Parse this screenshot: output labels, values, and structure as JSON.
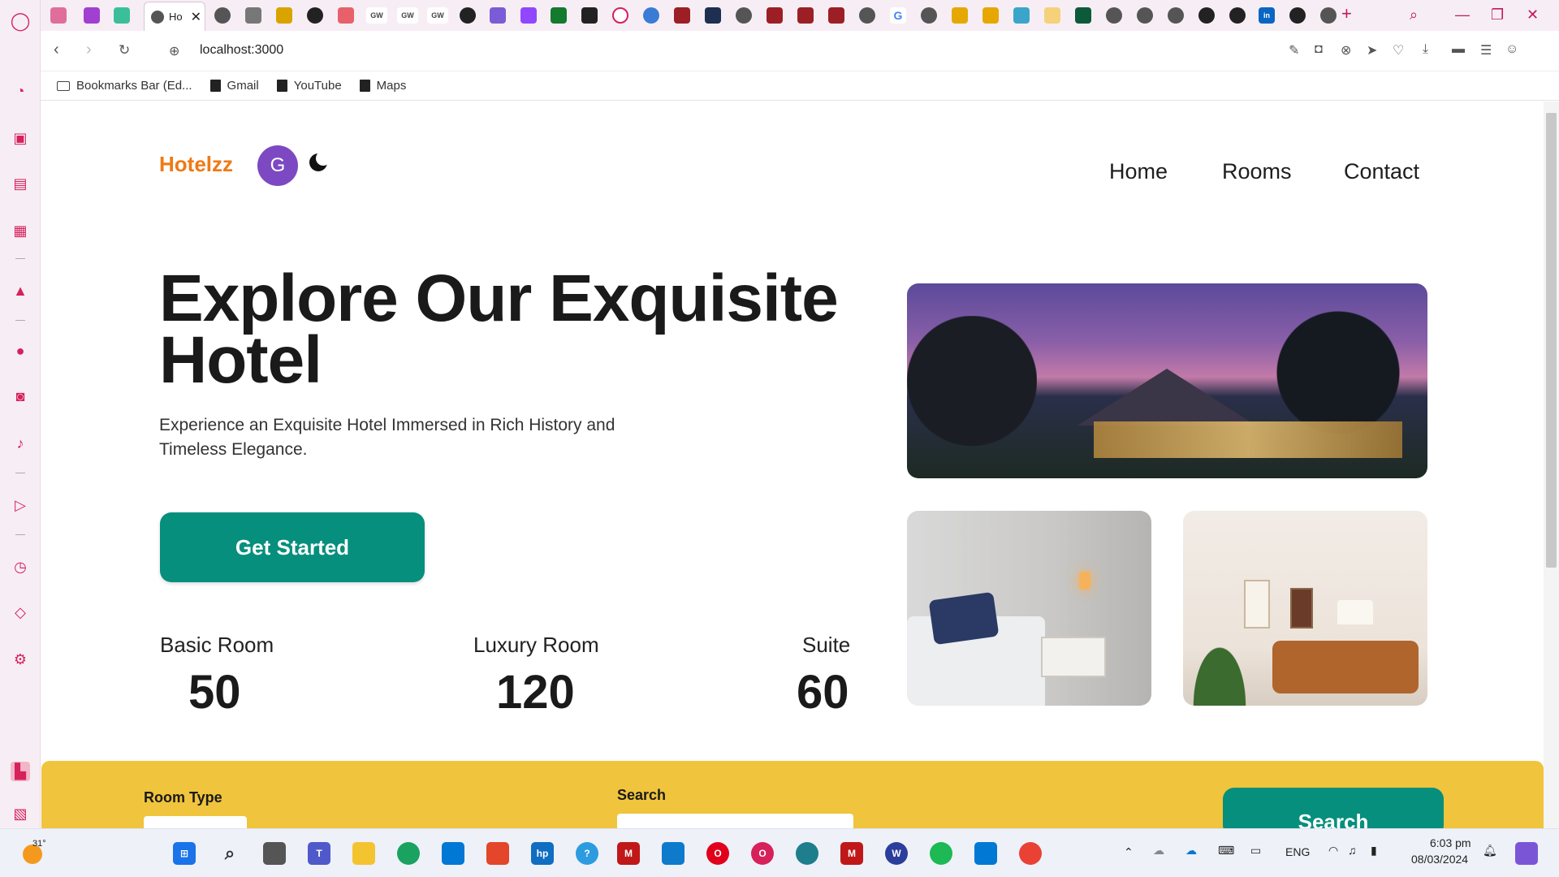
{
  "browser": {
    "active_tab_title": "Ho",
    "url": "localhost:3000",
    "bookmarks": [
      "Bookmarks Bar (Ed...",
      "Gmail",
      "YouTube",
      "Maps"
    ],
    "tab_favicons": [
      "GW",
      "GW",
      "GW",
      "G",
      "in"
    ]
  },
  "site": {
    "brand": "Hotelzz",
    "avatar_letter": "G",
    "nav": [
      "Home",
      "Rooms",
      "Contact"
    ],
    "hero_title": "Explore Our Exquisite Hotel",
    "hero_subtitle": "Experience an Exquisite Hotel Immersed in Rich History and Timeless Elegance.",
    "cta_label": "Get Started",
    "stats": [
      {
        "label": "Basic Room",
        "value": "50"
      },
      {
        "label": "Luxury Room",
        "value": "120"
      },
      {
        "label": "Suite",
        "value": "60"
      }
    ],
    "search_panel": {
      "room_type_label": "Room Type",
      "search_label": "Search",
      "button_label": "Search"
    }
  },
  "taskbar": {
    "weather": "31°",
    "language": "ENG",
    "time": "6:03 pm",
    "date": "08/03/2024"
  },
  "colors": {
    "brand": "#ee7a16",
    "accent_teal": "#068f7d",
    "avatar": "#7c49c3",
    "panel_yellow": "#f0c43c",
    "sidebar_pink": "#d6215b"
  }
}
